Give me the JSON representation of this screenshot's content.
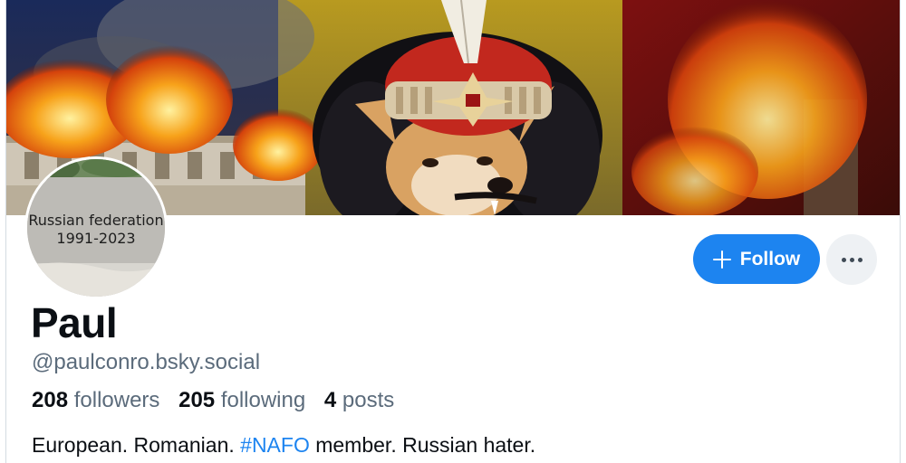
{
  "banner": {
    "image": "Romanian flag backdrop with burning buildings and a Shiba dog wearing a feathered hat and black curly wig"
  },
  "avatar": {
    "line1": "Russian federation",
    "line2": "1991-2023"
  },
  "actions": {
    "follow_label": "Follow",
    "follow_icon": "plus-icon",
    "more_icon": "ellipsis-icon"
  },
  "profile": {
    "display_name": "Paul",
    "handle": "@paulconro.bsky.social",
    "followers_count": "208",
    "followers_label": "followers",
    "following_count": "205",
    "following_label": "following",
    "posts_count": "4",
    "posts_label": "posts",
    "bio_part1": "European. Romanian.",
    "bio_hashtag": "#NAFO",
    "bio_part2": "member. Russian hater."
  },
  "colors": {
    "accent": "#1d84f0",
    "flag_blue": "#1d3f8f",
    "flag_yellow": "#c9ab2c",
    "flag_red": "#9b1c1c"
  }
}
